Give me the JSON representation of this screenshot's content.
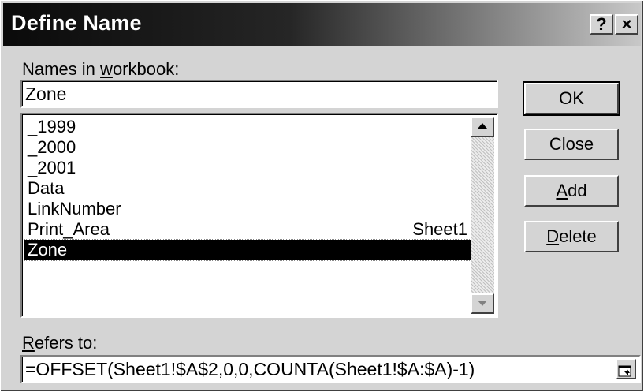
{
  "window": {
    "title": "Define Name"
  },
  "titlebar": {
    "help_label": "?",
    "close_label": "×"
  },
  "names_label": {
    "pre": "Names in ",
    "accel": "w",
    "post": "orkbook:"
  },
  "name_field": {
    "value": "Zone"
  },
  "names_list": {
    "items": [
      {
        "name": "_1999",
        "sheet": ""
      },
      {
        "name": "_2000",
        "sheet": ""
      },
      {
        "name": "_2001",
        "sheet": ""
      },
      {
        "name": "Data",
        "sheet": ""
      },
      {
        "name": "LinkNumber",
        "sheet": ""
      },
      {
        "name": "Print_Area",
        "sheet": "Sheet1"
      },
      {
        "name": "Zone",
        "sheet": ""
      }
    ],
    "selected_index": 6
  },
  "buttons": {
    "ok": {
      "label": "OK"
    },
    "close": {
      "label": "Close"
    },
    "add": {
      "accel": "A",
      "rest": "dd"
    },
    "delete": {
      "accel": "D",
      "rest": "elete"
    }
  },
  "refers_label": {
    "accel": "R",
    "rest": "efers to:"
  },
  "refers_field": {
    "value": "=OFFSET(Sheet1!$A$2,0,0,COUNTA(Sheet1!$A:$A)-1)"
  },
  "icons": {
    "help": "help-icon",
    "close": "close-icon",
    "scroll_up": "up-arrow-icon",
    "scroll_down": "down-arrow-icon",
    "collapse": "collapse-dialog-icon"
  }
}
